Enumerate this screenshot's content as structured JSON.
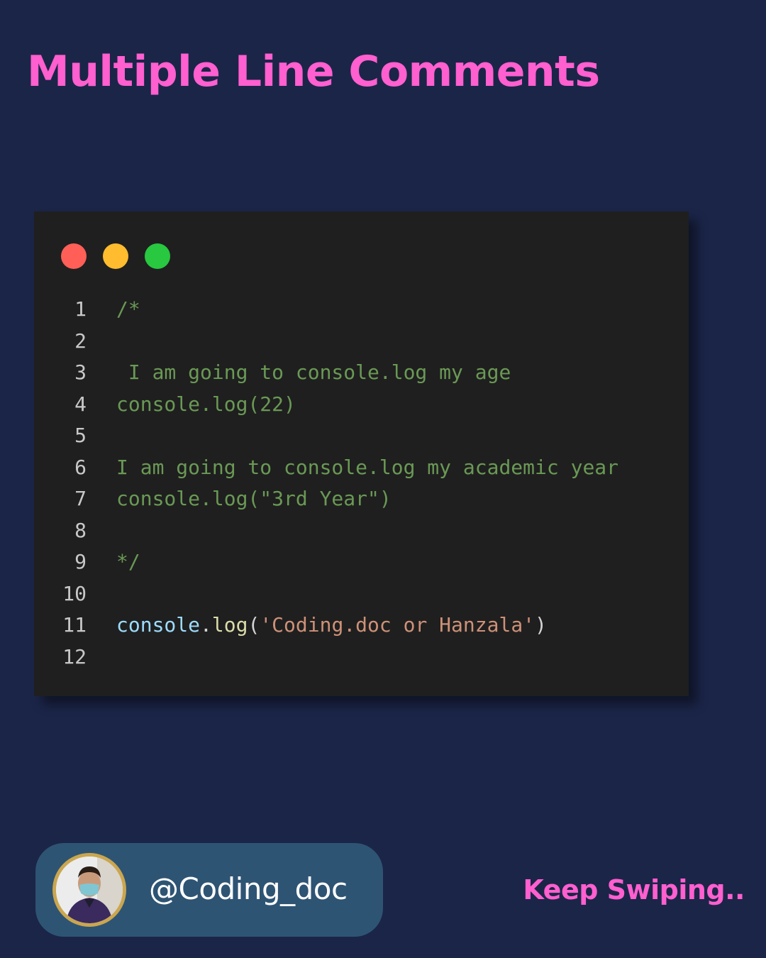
{
  "title": "Multiple Line Comments",
  "window_dots": [
    {
      "name": "close",
      "color": "#ff5f57"
    },
    {
      "name": "minimize",
      "color": "#febc2e"
    },
    {
      "name": "maximize",
      "color": "#28c840"
    }
  ],
  "code": {
    "lines": [
      {
        "number": "1",
        "tokens": [
          {
            "type": "comment",
            "text": "/*"
          }
        ]
      },
      {
        "number": "2",
        "tokens": []
      },
      {
        "number": "3",
        "tokens": [
          {
            "type": "comment",
            "text": " I am going to console.log my age"
          }
        ]
      },
      {
        "number": "4",
        "tokens": [
          {
            "type": "comment",
            "text": "console.log(22)"
          }
        ]
      },
      {
        "number": "5",
        "tokens": []
      },
      {
        "number": "6",
        "tokens": [
          {
            "type": "comment",
            "text": "I am going to console.log my academic year"
          }
        ]
      },
      {
        "number": "7",
        "tokens": [
          {
            "type": "comment",
            "text": "console.log(\"3rd Year\")"
          }
        ]
      },
      {
        "number": "8",
        "tokens": []
      },
      {
        "number": "9",
        "tokens": [
          {
            "type": "comment",
            "text": "*/"
          }
        ]
      },
      {
        "number": "10",
        "tokens": []
      },
      {
        "number": "11",
        "tokens": [
          {
            "type": "var",
            "text": "console"
          },
          {
            "type": "punc",
            "text": "."
          },
          {
            "type": "func",
            "text": "log"
          },
          {
            "type": "punc",
            "text": "("
          },
          {
            "type": "string",
            "text": "'Coding.doc or Hanzala'"
          },
          {
            "type": "punc",
            "text": ")"
          }
        ]
      },
      {
        "number": "12",
        "tokens": []
      }
    ]
  },
  "profile": {
    "handle": "@Coding_doc"
  },
  "footer": {
    "cta": "Keep Swiping.."
  }
}
